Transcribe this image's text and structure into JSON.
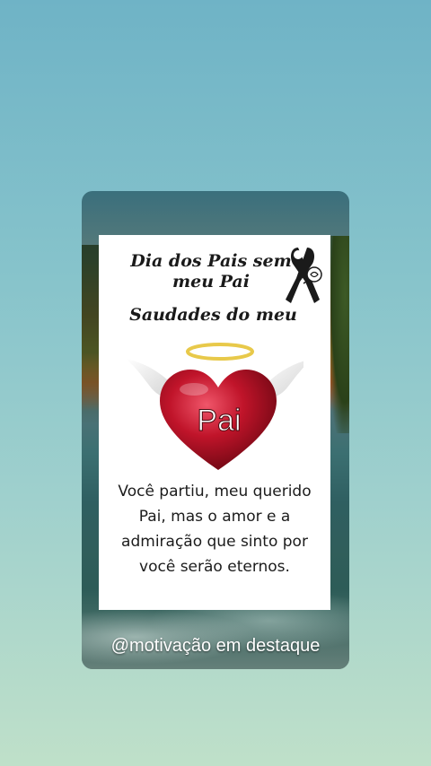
{
  "card": {
    "headline_line1": "Dia dos Pais sem meu Pai",
    "headline_line2": "Saudades do meu",
    "heart_label": "Pai",
    "message": "Você partiu, meu querido Pai, mas o amor e a admiração que sinto por você serão eternos.",
    "watermark": "@motivação em destaque"
  },
  "icons": {
    "ribbon": "mourning-ribbon-with-rose",
    "heart": "winged-heart-with-halo"
  },
  "colors": {
    "heart": "#c0142a",
    "halo": "#e8c94a",
    "ribbon": "#1a1a1a"
  }
}
